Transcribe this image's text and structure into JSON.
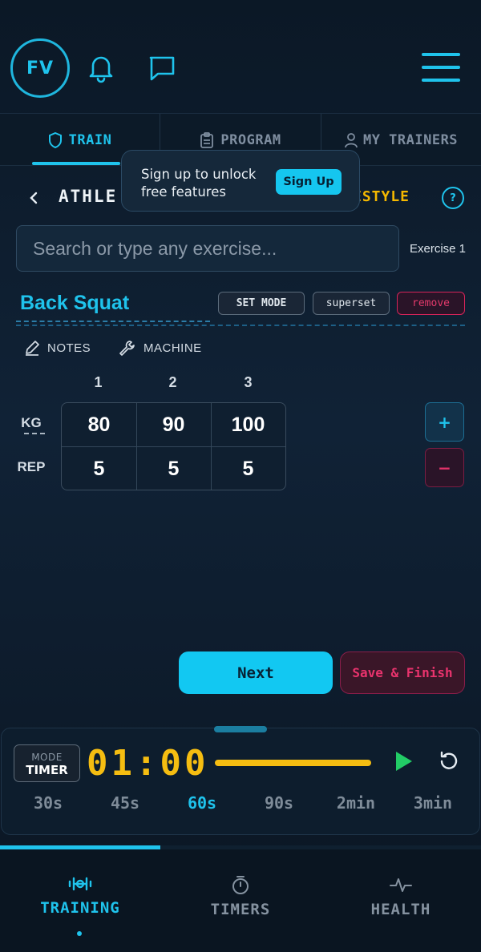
{
  "header": {
    "avatar_initials": "FV",
    "icons": [
      "bell-icon",
      "chat-icon",
      "menu-icon"
    ]
  },
  "tabs": [
    {
      "label": "TRAIN",
      "icon": "shield-icon",
      "active": true
    },
    {
      "label": "PROGRAM",
      "icon": "clipboard-icon",
      "active": false
    },
    {
      "label": "MY TRAINERS",
      "icon": "user-icon",
      "active": false
    }
  ],
  "tooltip": {
    "text": "Sign up to unlock free features",
    "button_label": "Sign Up"
  },
  "subheader": {
    "mode_left": "ATHLE",
    "mode_right": "ESTYLE",
    "help_label": "?"
  },
  "search": {
    "placeholder": "Search or type any exercise...",
    "value": ""
  },
  "exercise": {
    "number_label": "Exercise 1",
    "name": "Back Squat",
    "set_mode_label": "SET MODE",
    "superset_label": "superset",
    "remove_label": "remove",
    "notes_label": "NOTES",
    "machine_label": "MACHINE",
    "set_numbers": [
      "1",
      "2",
      "3"
    ],
    "row_labels": {
      "weight": "KG",
      "reps": "REP"
    },
    "weights": [
      "80",
      "90",
      "100"
    ],
    "reps": [
      "5",
      "5",
      "5"
    ],
    "add_label": "+",
    "remove_set_label": "−"
  },
  "actions": {
    "next_label": "Next",
    "save_label": "Save & Finish"
  },
  "timer": {
    "mode_top": "MODE",
    "mode_bottom": "TIMER",
    "display": "01:00",
    "presets": [
      "30s",
      "45s",
      "60s",
      "90s",
      "2min",
      "3min"
    ],
    "active_preset": "60s"
  },
  "bottom_nav": [
    {
      "label": "TRAINING",
      "icon": "dumbbell-icon",
      "active": true
    },
    {
      "label": "TIMERS",
      "icon": "stopwatch-icon",
      "active": false
    },
    {
      "label": "HEALTH",
      "icon": "heartbeat-icon",
      "active": false
    }
  ],
  "colors": {
    "accent": "#1fc3ec",
    "timer": "#f5bd11",
    "danger": "#e3336a",
    "play": "#22cc66",
    "freestyle": "#f5b800"
  }
}
